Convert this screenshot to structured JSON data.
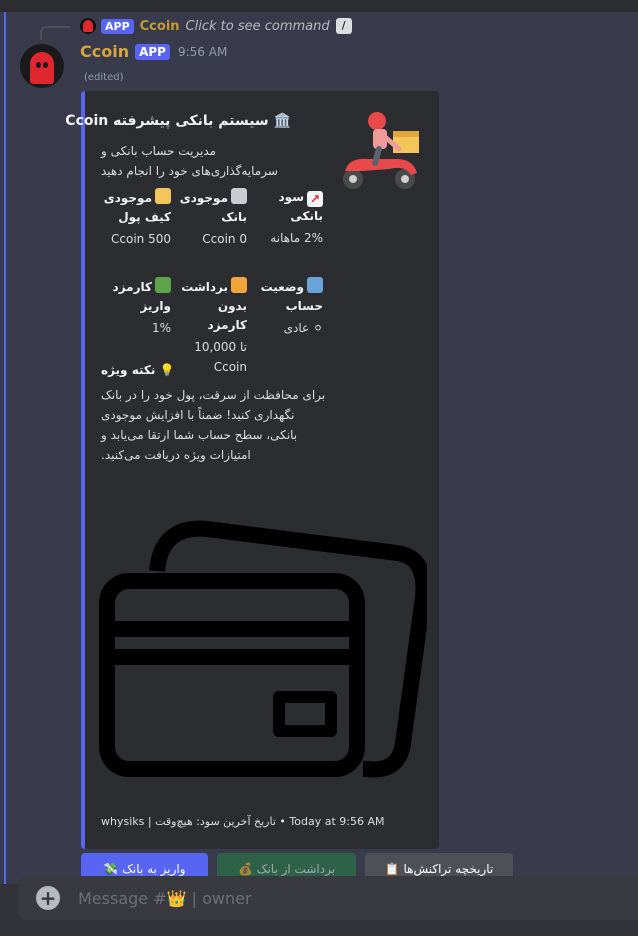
{
  "reply": {
    "app_tag": "APP",
    "name": "Ccoin",
    "command_text": "Click to see command"
  },
  "message": {
    "username": "Ccoin",
    "app_tag": "APP",
    "timestamp": "9:56 AM",
    "edited": "(edited)"
  },
  "embed": {
    "title": "🏛️ سیستم بانکی پیشرفته Ccoin",
    "description": "مدیریت حساب بانکی و سرمایه‌گذاری‌های خود را انجام دهید",
    "fields": [
      {
        "icon": "💳",
        "name": "موجودی کیف پول",
        "value": "500 Ccoin"
      },
      {
        "icon": "🏛️",
        "name": "موجودی بانک",
        "value": "0 Ccoin"
      },
      {
        "icon": "📈",
        "name": "سود بانکی",
        "value": "2% ماهانه"
      },
      {
        "icon": "💸",
        "name": "کارمزد واریز",
        "value": "1%"
      },
      {
        "icon": "🔐",
        "name": "برداشت بدون کارمزد",
        "value": "تا 10,000 Ccoin"
      },
      {
        "icon": "📊",
        "name": "وضعیت حساب",
        "value": "⚪ عادی"
      }
    ],
    "note_title": "💡 نکته ویژه",
    "note_body": "برای محافظت از سرقت، پول خود را در بانک نگهداری کنید! ضمناً با افزایش موجودی بانکی، سطح حساب شما ارتقا می‌یابد و امتیازات ویژه دریافت می‌کنید.",
    "footer": "whysiks | تاریخ آخرین سود: هیچ‌وقت • Today at 9:56 AM"
  },
  "buttons": [
    {
      "label": "💸 واریز به بانک",
      "color": "#5865f2"
    },
    {
      "label": "💰 برداشت از بانک",
      "color": "#248046"
    },
    {
      "label": "📋 تاریخچه تراکنش‌ها",
      "color": "#4e5058"
    }
  ],
  "composer": {
    "placeholder": "Message #👑 | owner"
  },
  "icons": {
    "reply_avatar": "ghost-icon",
    "avatar": "ghost-icon",
    "command": "slash-command-icon",
    "thumbnail": "delivery-scooter-icon",
    "image": "wallet-cards-icon",
    "attach": "plus-icon"
  }
}
